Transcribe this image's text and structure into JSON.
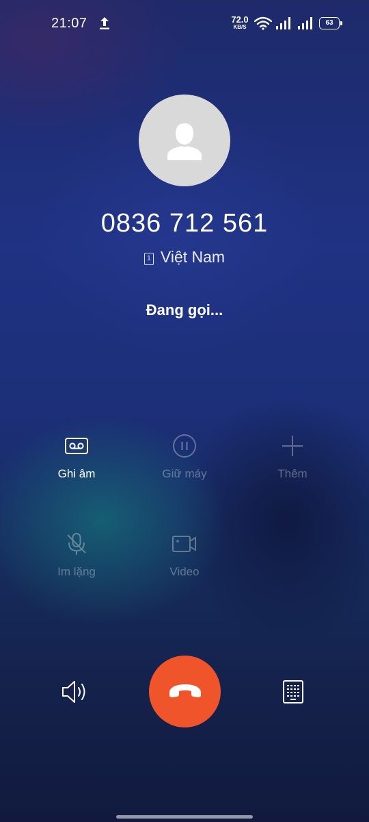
{
  "status_bar": {
    "time": "21:07",
    "net_speed_value": "72.0",
    "net_speed_unit": "KB/S",
    "battery": "63",
    "icons": [
      "upload-icon",
      "wifi-icon",
      "signal-icon",
      "signal-icon",
      "battery-icon"
    ]
  },
  "call": {
    "number": "0836 712 561",
    "sim_slot": "1",
    "location": "Việt Nam",
    "status": "Đang gọi..."
  },
  "actions": [
    {
      "label": "Ghi âm",
      "icon": "record-icon",
      "enabled": true
    },
    {
      "label": "Giữ máy",
      "icon": "pause-icon",
      "enabled": false
    },
    {
      "label": "Thêm",
      "icon": "plus-icon",
      "enabled": false
    },
    {
      "label": "Im lặng",
      "icon": "mic-off-icon",
      "enabled": false
    },
    {
      "label": "Video",
      "icon": "video-icon",
      "enabled": false
    }
  ],
  "bottom_controls": {
    "speaker_icon": "speaker-icon",
    "end_call_icon": "end-call-icon",
    "keypad_icon": "keypad-icon",
    "end_call_color": "#f0542b"
  }
}
